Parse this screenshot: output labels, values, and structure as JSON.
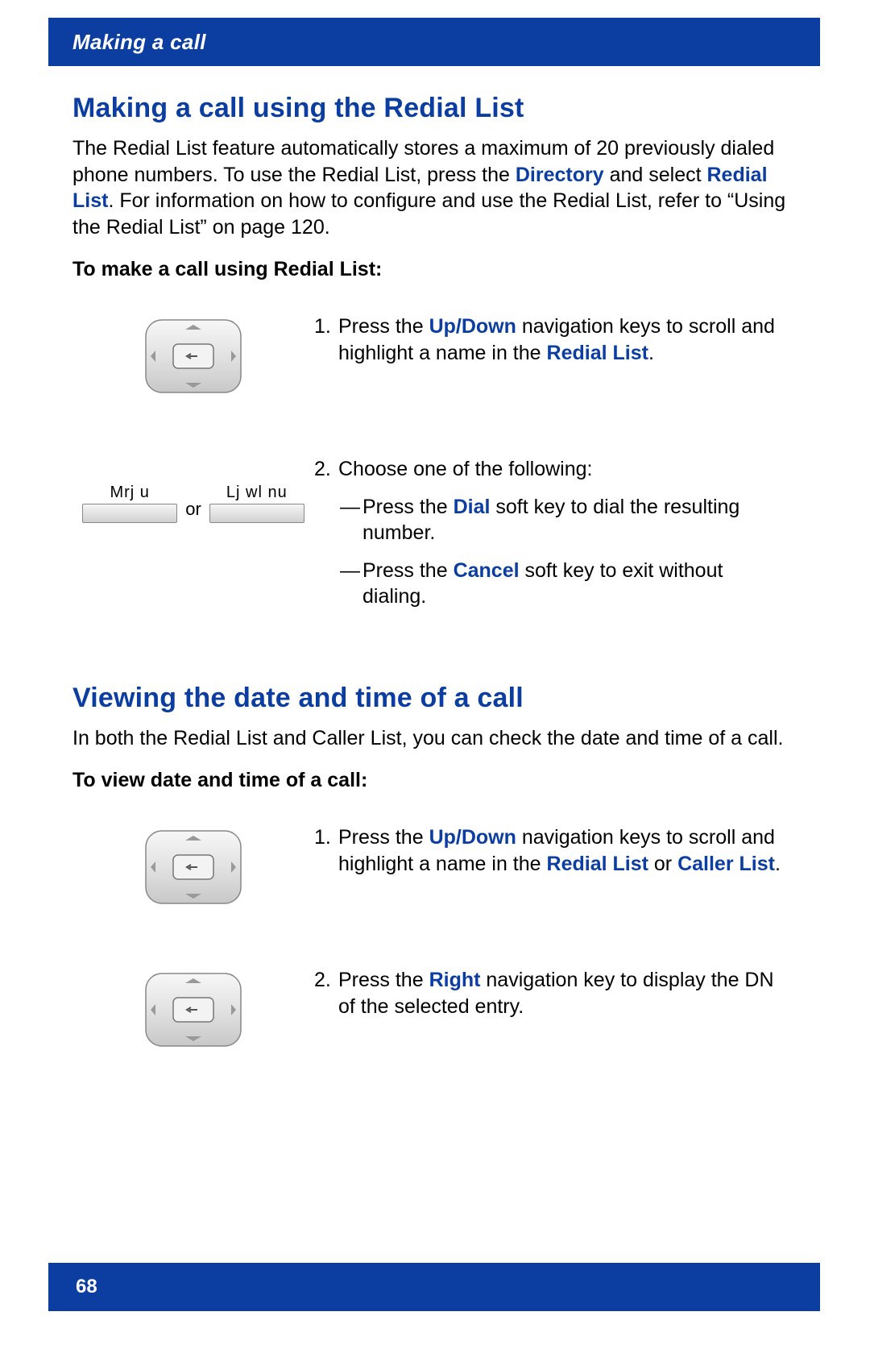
{
  "header": {
    "title": "Making a call"
  },
  "section1": {
    "heading": "Making a call using the Redial List",
    "intro_parts": {
      "p1": "The Redial List feature automatically stores a maximum of 20 previously dialed phone numbers. To use the Redial List, press the ",
      "directory": "Directory",
      "p2": " and select ",
      "redial_list": "Redial List",
      "p3": ". For information on how to configure and use the Redial List, refer to “Using the Redial List” on page 120."
    },
    "subhead": "To make a call using Redial List:",
    "step1": {
      "num": "1.",
      "t1": "Press the ",
      "updown": "Up/Down",
      "t2": " navigation keys to scroll and highlight a name in the ",
      "redial_list": "Redial List",
      "t3": "."
    },
    "step2": {
      "num": "2.",
      "intro": "Choose one of the following:",
      "softkeys": {
        "left": "Mrj u",
        "right": "Lj wl nu",
        "or": "or"
      },
      "b1": {
        "t1": "Press the ",
        "dial": "Dial",
        "t2": " soft key to dial the resulting number."
      },
      "b2": {
        "t1": "Press the ",
        "cancel": "Cancel",
        "t2": " soft key to exit without dialing."
      }
    }
  },
  "section2": {
    "heading": "Viewing the date and time of a call",
    "intro": "In both the Redial List and Caller List, you can check the date and time of a call.",
    "subhead": "To view date and time of a call:",
    "step1": {
      "num": "1.",
      "t1": "Press the ",
      "updown": "Up/Down",
      "t2": " navigation keys to scroll and highlight a name in the ",
      "redial_list": "Redial List",
      "or": " or ",
      "caller_list": "Caller List",
      "t3": "."
    },
    "step2": {
      "num": "2.",
      "t1": "Press the ",
      "right": "Right",
      "t2": " navigation key to display the DN of the selected entry."
    }
  },
  "footer": {
    "page": "68"
  }
}
